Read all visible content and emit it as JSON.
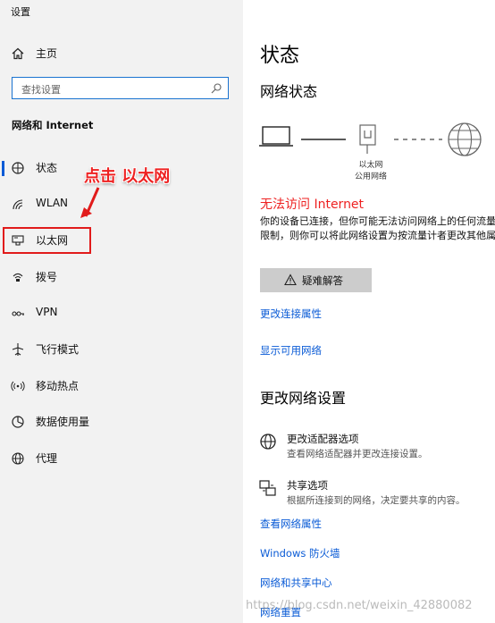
{
  "window": {
    "title": "设置"
  },
  "sidebar": {
    "home_label": "主页",
    "search_placeholder": "查找设置",
    "section_title": "网络和 Internet",
    "items": [
      {
        "label": "状态",
        "icon": "status-icon",
        "selected": true
      },
      {
        "label": "WLAN",
        "icon": "wifi-icon"
      },
      {
        "label": "以太网",
        "icon": "ethernet-icon"
      },
      {
        "label": "拨号",
        "icon": "dialup-icon"
      },
      {
        "label": "VPN",
        "icon": "vpn-icon"
      },
      {
        "label": "飞行模式",
        "icon": "airplane-icon"
      },
      {
        "label": "移动热点",
        "icon": "hotspot-icon"
      },
      {
        "label": "数据使用量",
        "icon": "data-usage-icon"
      },
      {
        "label": "代理",
        "icon": "globe-icon"
      }
    ]
  },
  "annotation": {
    "text": "点击 以太网",
    "color": "#ee2222"
  },
  "main": {
    "title": "状态",
    "network_status_heading": "网络状态",
    "diagram_label": [
      "以太网",
      "公用网络"
    ],
    "error_title": "无法访问 Internet",
    "description": "你的设备已连接，但你可能无法访问网络上的任何流量套餐有限制，则你可以将此网络设置为按流量计者更改其他属性。",
    "troubleshoot_label": "疑难解答",
    "links": {
      "change_props": "更改连接属性",
      "show_networks": "显示可用网络"
    },
    "change_settings_heading": "更改网络设置",
    "options": [
      {
        "title": "更改适配器选项",
        "subtitle": "查看网络适配器并更改连接设置。",
        "icon": "adapter-globe-icon"
      },
      {
        "title": "共享选项",
        "subtitle": "根据所连接到的网络，决定要共享的内容。",
        "icon": "sharing-icon"
      }
    ],
    "bottom_links": [
      "查看网络属性",
      "Windows 防火墙",
      "网络和共享中心",
      "网络重置"
    ]
  },
  "watermark": "https://blog.csdn.net/weixin_42880082",
  "colors": {
    "accent": "#0a5bd6",
    "error": "#ee2222",
    "sidebar_bg": "#f2f2f2"
  }
}
